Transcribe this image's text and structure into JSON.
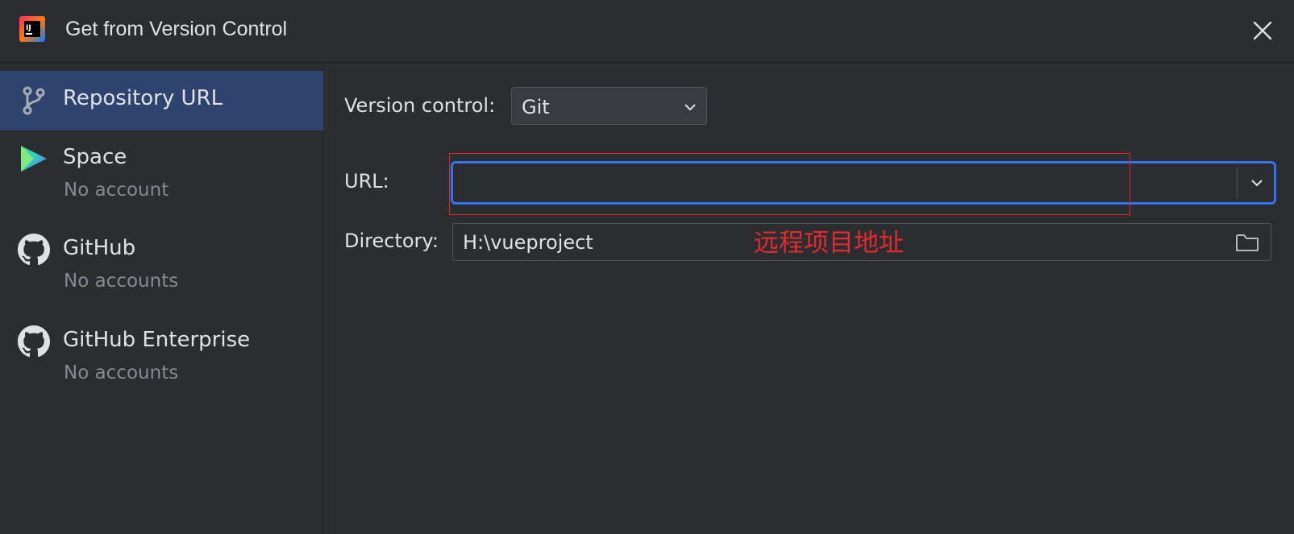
{
  "window": {
    "title": "Get from Version Control",
    "logo_icon": "intellij-logo-icon",
    "close_icon": "close-icon"
  },
  "sidebar": {
    "items": [
      {
        "label": "Repository URL",
        "sub": "",
        "icon": "vcs-branch-icon",
        "selected": true
      },
      {
        "label": "Space",
        "sub": "No account",
        "icon": "space-logo-icon",
        "selected": false
      },
      {
        "label": "GitHub",
        "sub": "No accounts",
        "icon": "github-icon",
        "selected": false
      },
      {
        "label": "GitHub Enterprise",
        "sub": "No accounts",
        "icon": "github-icon",
        "selected": false
      }
    ]
  },
  "form": {
    "version_control_label": "Version control:",
    "version_control_value": "Git",
    "url_label": "URL:",
    "url_value": "",
    "directory_label": "Directory:",
    "directory_value": "H:\\vueproject"
  },
  "annotation": {
    "text": "远程项目地址",
    "color": "#e0262b"
  },
  "colors": {
    "background": "#2b2d30",
    "selection": "#2e436e",
    "focus_border": "#3574f0",
    "muted_text": "#868a91"
  }
}
